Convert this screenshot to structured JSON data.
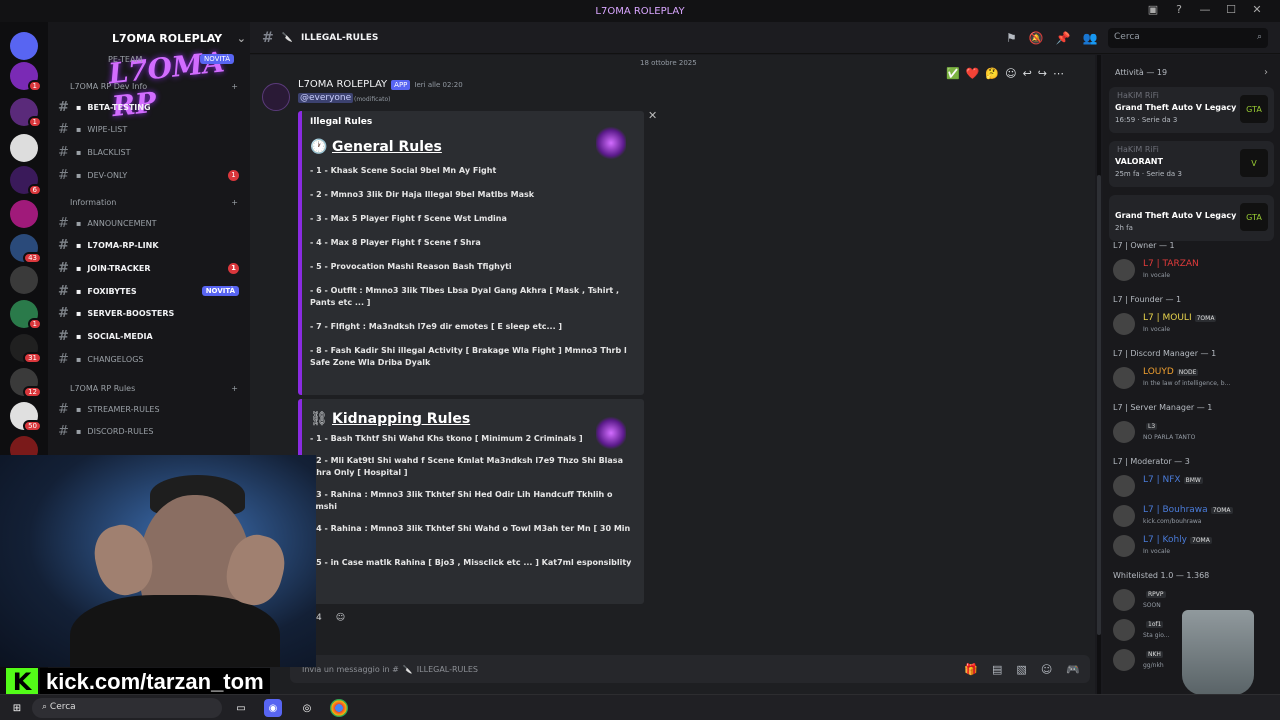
{
  "window": {
    "title": "L7OMA ROLEPLAY"
  },
  "server": {
    "name": "L7OMA ROLEPLAY",
    "logo_text": "L7OMA RP"
  },
  "servers": [
    {
      "badge": "1"
    },
    {
      "badge": "1"
    },
    {
      "badge": ""
    },
    {
      "badge": "6"
    },
    {
      "badge": ""
    },
    {
      "badge": "43"
    },
    {
      "badge": ""
    },
    {
      "badge": "1"
    },
    {
      "badge": "31"
    },
    {
      "badge": "12"
    },
    {
      "badge": "50"
    }
  ],
  "channels": {
    "top_channel": {
      "label": "PE-TEAM",
      "badge": "NOVITÀ"
    },
    "cat_dev": "L7OMA RP Dev Info",
    "dev": [
      {
        "label": "BETA-TESTING",
        "bold": true
      },
      {
        "label": "WIPE-LIST"
      },
      {
        "label": "BLACKLIST"
      },
      {
        "label": "DEV-ONLY",
        "badge": "1"
      }
    ],
    "cat_info": "Information",
    "info": [
      {
        "label": "ANNOUNCEMENT"
      },
      {
        "label": "L7OMA-RP-LINK",
        "bold": true
      },
      {
        "label": "JOIN-TRACKER",
        "bold": true,
        "badge": "1"
      },
      {
        "label": "FOXIBYTES",
        "bold": true,
        "new": "NOVITÀ"
      },
      {
        "label": "SERVER-BOOSTERS",
        "bold": true
      },
      {
        "label": "SOCIAL-MEDIA",
        "bold": true
      },
      {
        "label": "CHANGELOGS"
      }
    ],
    "cat_rules": "L7OMA RP Rules",
    "rules": [
      {
        "label": "STREAMER-RULES"
      },
      {
        "label": "DISCORD-RULES"
      }
    ]
  },
  "topbar": {
    "channel": "ILLEGAL-RULES",
    "search_placeholder": "Cerca"
  },
  "message": {
    "date": "18 ottobre 2025",
    "author": "L7OMA ROLEPLAY",
    "app_tag": "APP",
    "timestamp": "Ieri alle 02:20",
    "mention": "@everyone",
    "edited": "(modificato)"
  },
  "embed1": {
    "title": "Illegal Rules",
    "heading": "General Rules",
    "rules": [
      "- 1 - Khask Scene Social 9bel Mn Ay Fight",
      "- 2 - Mmno3 3lik Dir Haja Illegal 9bel Matlbs Mask",
      "- 3 - Max 5 Player Fight f Scene Wst Lmdina",
      "- 4 - Max 8 Player Fight f Scene f Shra",
      "- 5 - Provocation Mashi Reason Bash Tfighyti",
      "- 6 - Outfit : Mmno3 3lik Tlbes Lbsa Dyal Gang Akhra [ Mask , Tshirt , Pants etc ... ]",
      "- 7 - Flfight : Ma3ndksh l7e9 dir emotes [ E sleep etc... ]",
      "- 8 - Fash Kadir Shi illegal Activity [ Brakage Wla Fight ] Mmno3 Thrb l Safe Zone Wla Driba Dyalk"
    ]
  },
  "embed2": {
    "heading": "Kidnapping Rules",
    "rules": [
      "- 1 - Bash Tkhtf Shi Wahd Khs tkono [ Minimum 2 Criminals ]",
      "- 2 - Mli Kat9tl Shi wahd f Scene Kmlat Ma3ndksh l7e9 Thzo Shi Blasa Khra Only [ Hospital ]",
      "- 3 - Rahina : Mmno3 3lik Tkhtef Shi Hed Odir Lih Handcuff Tkhlih o Tmshi",
      "- 4 - Rahina : Mmno3 3lik Tkhtef Shi Wahd o Towl M3ah ter Mn [ 30 Min ]",
      "- 5 - in Case matlk Rahina [ Bjo3 , Missclick etc ... ] Kat7ml esponsiblity"
    ]
  },
  "reaction_count": "4",
  "input": {
    "placeholder": "Invia un messaggio in # ",
    "channel": "ILLEGAL-RULES"
  },
  "members": {
    "activity_header": "Attività — 19",
    "activities": [
      {
        "user": "HaKiM RiFi",
        "game": "Grand Theft Auto V Legacy",
        "detail": "16:59 · Serie da 3",
        "icon": "GTA"
      },
      {
        "user": "HaKiM RiFi",
        "game": "VALORANT",
        "detail": "25m fa · Serie da 3",
        "icon": "V"
      },
      {
        "user": "",
        "game": "Grand Theft Auto V Legacy",
        "detail": "2h fa",
        "icon": "GTA"
      }
    ],
    "roles": [
      {
        "role": "L7 | Owner — 1",
        "members": [
          {
            "name": "L7 | TARZAN",
            "status": "In vocale",
            "color": "#e23b3b"
          }
        ]
      },
      {
        "role": "L7 | Founder — 1",
        "members": [
          {
            "name": "L7 | MOULI",
            "tag": "7OMA",
            "status": "In vocale",
            "color": "#e8d44d"
          }
        ]
      },
      {
        "role": "L7 | Discord Manager — 1",
        "members": [
          {
            "name": "LOUYD",
            "tag": "NODE",
            "status": "In the law of intelligence, b...",
            "color": "#f0a030"
          }
        ]
      },
      {
        "role": "L7 | Server Manager — 1",
        "members": [
          {
            "name": "",
            "tag": "L3",
            "status": "NO PARLA TANTO",
            "color": "#7d5fff"
          }
        ]
      },
      {
        "role": "L7 | Moderator — 3",
        "members": [
          {
            "name": "L7 | NFX",
            "tag": "BMW",
            "status": "",
            "color": "#4a7bd8"
          },
          {
            "name": "L7 | Bouhrawa",
            "tag": "7OMA",
            "status": "kick.com/bouhrawa",
            "color": "#4a7bd8"
          },
          {
            "name": "L7 | Kohly",
            "tag": "7OMA",
            "status": "In vocale",
            "color": "#4a7bd8"
          }
        ]
      },
      {
        "role": "Whitelisted 1.0 — 1.368",
        "members": [
          {
            "name": "",
            "tag": "RPVP",
            "status": "SOON",
            "color": "#cfcfcf"
          },
          {
            "name": "",
            "tag": "1of1",
            "status": "Sta gio...",
            "color": "#cfcfcf"
          },
          {
            "name": "",
            "tag": "NKH",
            "status": "gg/nkh",
            "color": "#cfcfcf"
          }
        ]
      }
    ]
  },
  "stream_banner": {
    "k": "K",
    "url": "kick.com/tarzan_tom"
  },
  "taskbar": {
    "search": "Cerca"
  }
}
